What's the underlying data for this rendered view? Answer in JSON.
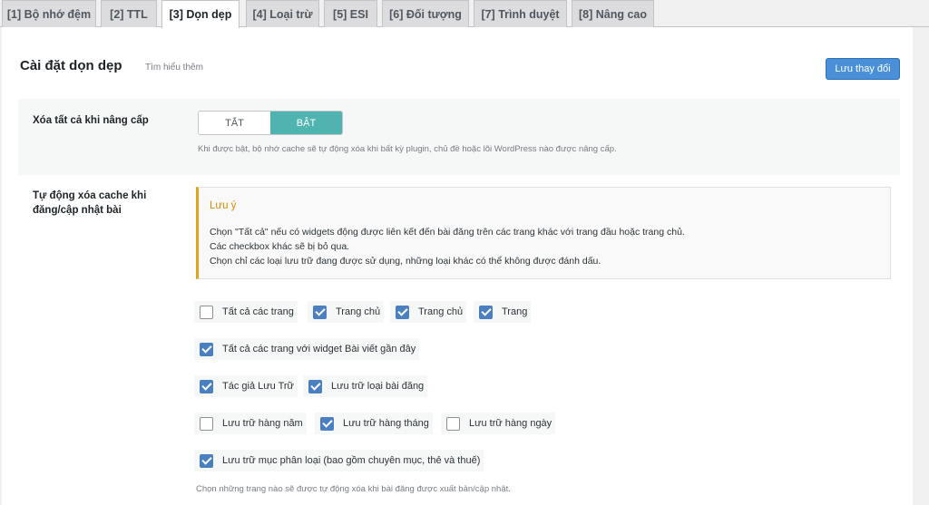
{
  "tabs": [
    {
      "label": "[1] Bộ nhớ đệm",
      "active": false
    },
    {
      "label": "[2] TTL",
      "active": false
    },
    {
      "label": "[3] Dọn dẹp",
      "active": true
    },
    {
      "label": "[4] Loại trừ",
      "active": false
    },
    {
      "label": "[5] ESI",
      "active": false
    },
    {
      "label": "[6] Đối tượng",
      "active": false
    },
    {
      "label": "[7] Trình duyệt",
      "active": false
    },
    {
      "label": "[8] Nâng cao",
      "active": false
    }
  ],
  "header": {
    "title": "Cài đặt dọn dẹp",
    "learn_more": "Tìm hiểu thêm",
    "save_label": "Lưu thay đổi"
  },
  "purge_all_on_upgrade": {
    "label": "Xóa tất cả khi nâng cấp",
    "off_label": "TẮT",
    "on_label": "BẬT",
    "value": "on",
    "description": "Khi được bật, bộ nhớ cache sẽ tự động xóa khi bất kỳ plugin, chủ đề hoặc lõi WordPress nào được nâng cấp."
  },
  "auto_purge": {
    "label_line1": "Tự động xóa cache khi",
    "label_line2": "đăng/cập nhật bài",
    "note": {
      "title": "Lưu ý",
      "lines": [
        "Chọn \"Tất cả\" nếu có widgets động được liên kết đến bài đăng trên các trang khác với trang đầu hoặc trang chủ.",
        "Các checkbox khác sẽ bị bỏ qua.",
        "Chọn chỉ các loại lưu trữ đang được sử dụng, những loại khác có thể không được đánh dấu."
      ]
    },
    "options": [
      {
        "label": "Tất cả các trang",
        "checked": false
      },
      {
        "label": "Trang chủ",
        "checked": true
      },
      {
        "label": "Trang chủ",
        "checked": true
      },
      {
        "label": "Trang",
        "checked": true
      },
      {
        "label": "Tất cả các trang với widget Bài viết gần đây",
        "checked": true
      },
      {
        "label": "Tác giả Lưu Trữ",
        "checked": true
      },
      {
        "label": "Lưu trữ loại bài đăng",
        "checked": true
      },
      {
        "label": "Lưu trữ hàng năm",
        "checked": false
      },
      {
        "label": "Lưu trữ hàng tháng",
        "checked": true
      },
      {
        "label": "Lưu trữ hàng ngày",
        "checked": false
      },
      {
        "label": "Lưu trữ mục phân loại (bao gồm chuyên mục, thẻ và thuế)",
        "checked": true
      }
    ],
    "description": "Chọn những trang nào sẽ được tự động xóa khi bài đăng được xuất bản/cập nhật."
  },
  "colors": {
    "accent": "#4a90d9",
    "toggle_on": "#4fb3b0",
    "checkbox": "#4a7fc1",
    "note_border": "#e0a31c"
  }
}
